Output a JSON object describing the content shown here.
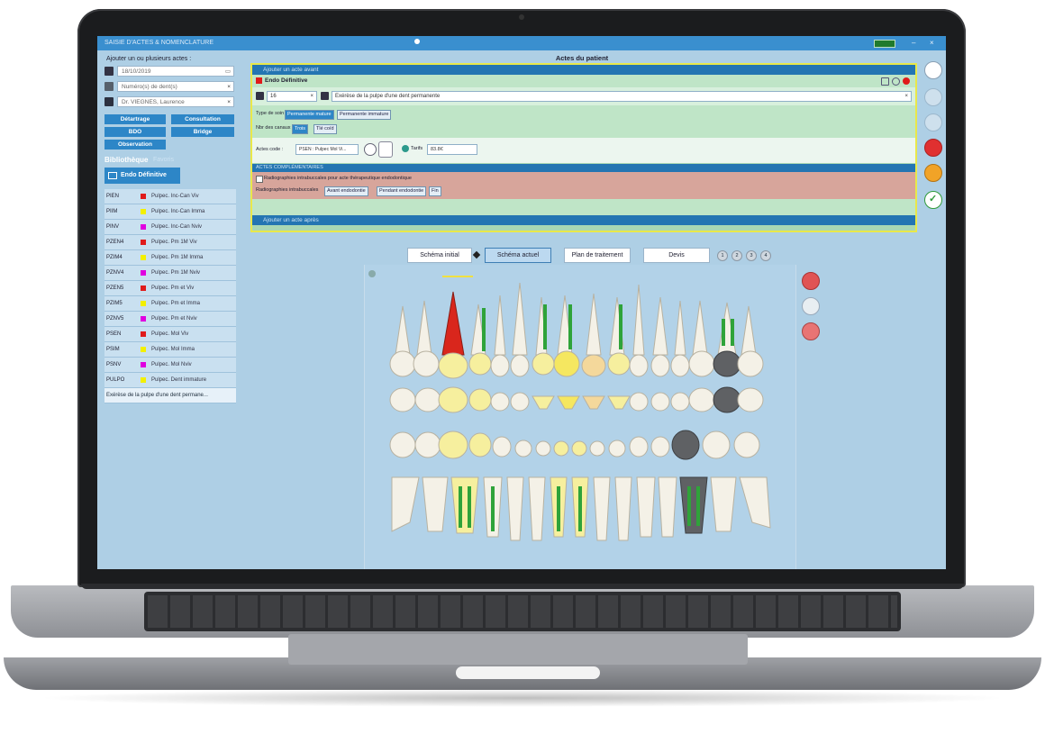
{
  "window": {
    "title": "SAISIE D'ACTES & NOMENCLATURE",
    "window_buttons": [
      "–",
      "×"
    ]
  },
  "left": {
    "add_label": "Ajouter un ou plusieurs actes :",
    "date": "18/10/2019",
    "teeth_placeholder": "Numéro(s) de dent(s)",
    "practitioner": "Dr. VIEGNES, Laurence",
    "quick_buttons": [
      "Détartrage",
      "Consultation",
      "BDO",
      "Bridge",
      "Observation"
    ],
    "library_label": "Bibliothèque",
    "favorites_label": "Favoris",
    "endo_button": "Endo Définitive",
    "codes": [
      {
        "code": "PIEN",
        "color": "#e01b1b",
        "desc": "Pulpec. Inc-Can  Viv"
      },
      {
        "code": "PIIM",
        "color": "#f3f000",
        "desc": "Pulpec. Inc-Can Imma"
      },
      {
        "code": "PINV",
        "color": "#e000e0",
        "desc": "Pulpec. Inc-Can Nviv"
      },
      {
        "code": "PZEN4",
        "color": "#e01b1b",
        "desc": "Pulpec. Pm 1M  Viv"
      },
      {
        "code": "PZIM4",
        "color": "#f3f000",
        "desc": "Pulpec. Pm 1M Imma"
      },
      {
        "code": "PZNV4",
        "color": "#e000e0",
        "desc": "Pulpec. Pm 1M Nviv"
      },
      {
        "code": "PZEN5",
        "color": "#e01b1b",
        "desc": "Pulpec. Pm et  Viv"
      },
      {
        "code": "PZIM5",
        "color": "#f3f000",
        "desc": "Pulpec. Pm et Imma"
      },
      {
        "code": "PZNV5",
        "color": "#e000e0",
        "desc": "Pulpec. Pm et Nviv"
      },
      {
        "code": "PSEN",
        "color": "#e01b1b",
        "desc": "Pulpec. Mol  Viv"
      },
      {
        "code": "PSIM",
        "color": "#f3f000",
        "desc": "Pulpec. Mol Imma"
      },
      {
        "code": "PSNV",
        "color": "#e000e0",
        "desc": "Pulpec. Mol Nviv"
      },
      {
        "code": "PULPO",
        "color": "#f3f000",
        "desc": "Pulpec. Dent immature"
      }
    ],
    "selected_desc": "Exérèse de la pulpe d'une dent permane..."
  },
  "main": {
    "title": "Actes du patient",
    "add_above": "Ajouter un acte avant",
    "act_name": "Endo Définitive",
    "tooth": "16",
    "act_desc": "Exérèse de la pulpe d'une dent permanente",
    "care_type_label": "Type de soin",
    "care_types": [
      "Permanente mature",
      "Permanente immature"
    ],
    "canals_label": "Nbr des canaux",
    "canals": [
      "Trois",
      "Tlé coïd"
    ],
    "acts_prefix": "Actes code :",
    "act_code": "PSEN : Pulpec Mol  Vi...",
    "fees_label": "Tarifs",
    "fees_value": "83.8€",
    "complementary_header": "ACTES COMPLÉMENTAIRES",
    "radio_item": "Radiographies intrabuccales pour acte thérapeutique endodontique",
    "radio_label": "Radiographies intrabuccales",
    "radio_options": [
      "Avant endodontie",
      "Pendant endodontie",
      "Fin"
    ],
    "add_after": "Ajouter un acte après"
  },
  "tabs": {
    "items": [
      "Schéma initial",
      "Schéma actuel",
      "Plan de traitement",
      "Devis"
    ],
    "active": 1,
    "pages": [
      "1",
      "2",
      "3",
      "4"
    ]
  },
  "colors": {
    "accent": "#2d86c7",
    "title_bar": "#3a8fcf",
    "panel_green": "#a9d7b4",
    "highlight_border": "#e9e84a",
    "pink_row": "#d7a59b"
  }
}
